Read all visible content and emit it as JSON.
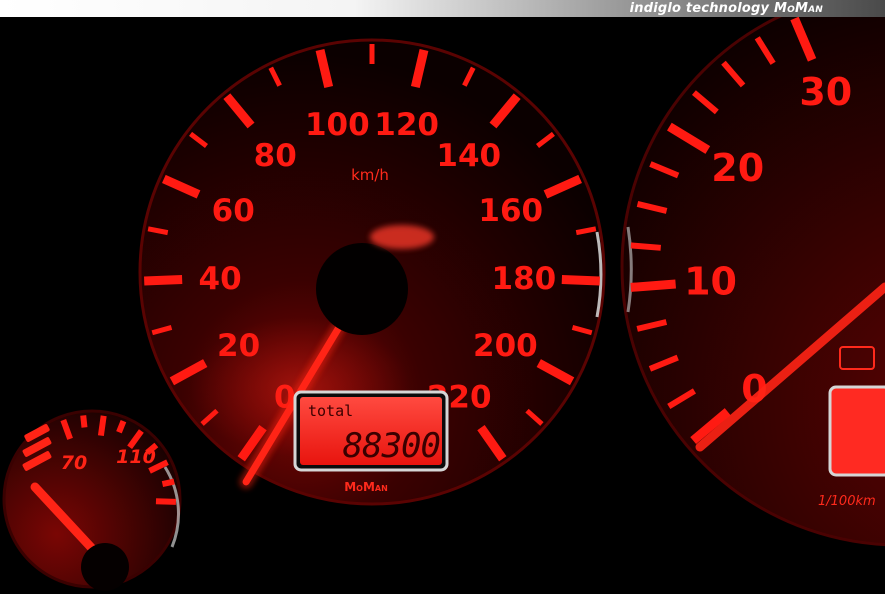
{
  "banner": {
    "tagline": "indiglo technology",
    "brand": "MoMan"
  },
  "speedometer": {
    "unit": "km/h",
    "scale_labels": [
      "0",
      "20",
      "40",
      "60",
      "80",
      "100",
      "120",
      "140",
      "160",
      "180",
      "200",
      "220"
    ],
    "needle_value_kmh": 0,
    "odometer_label": "total",
    "odometer_value": "88300",
    "maker_mark": "MoMan"
  },
  "right_gauge": {
    "scale_labels": [
      "0",
      "10",
      "20",
      "30"
    ],
    "unit_fragment": "1/100km"
  },
  "left_gauge": {
    "scale_labels": [
      "70",
      "110"
    ]
  },
  "colors": {
    "illumination": "#ff1a12",
    "background": "#000000",
    "lcd": "#ff2a22",
    "lcd_text": "#3a0000",
    "bezel": "#d8d8d8"
  }
}
